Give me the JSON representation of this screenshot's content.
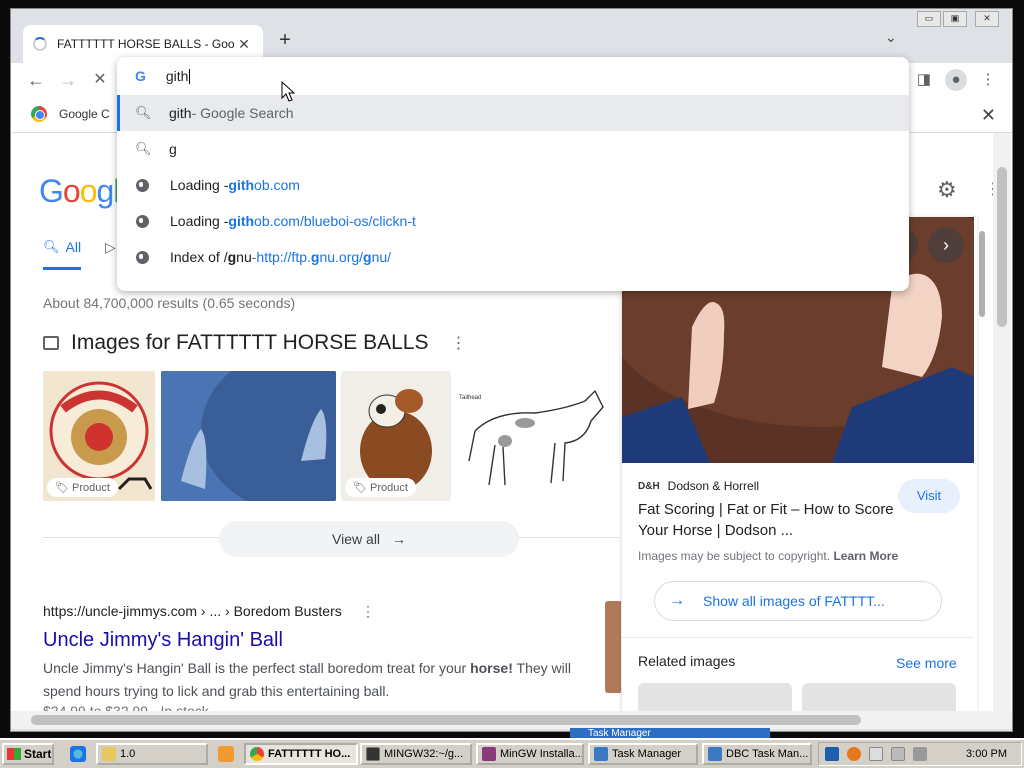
{
  "tab": {
    "title": "FATTTTTT HORSE BALLS - Google Search",
    "new_tab": "+",
    "close": "✕",
    "tab_search": "⌄"
  },
  "window_controls": [
    "▭",
    "▣",
    "✕"
  ],
  "omnibox": {
    "query": "gith",
    "suggestions": [
      {
        "main": "gith",
        "suffix": " - Google Search",
        "type": "search"
      },
      {
        "main": "g",
        "suffix": "",
        "type": "search"
      },
      {
        "main": "Loading - ",
        "bold": "gith",
        "rest": "ob.com",
        "type": "url"
      },
      {
        "main": "Loading - ",
        "bold": "gith",
        "rest": "ob.com/blueboi-os/clickn-t",
        "type": "url"
      },
      {
        "main": "Index of /",
        "g1": "g",
        "nu": "nu",
        "dash": " - ",
        "link_a": "http://ftp.",
        "g2": "g",
        "link_b": "nu.org/",
        "g3": "g",
        "link_c": "nu/",
        "type": "url"
      }
    ]
  },
  "bookmarks": {
    "first": "Google C"
  },
  "google": {
    "logo": "Googl",
    "tabs": {
      "all": "All"
    },
    "stats": "About 84,700,000 results (0.65 seconds)",
    "images_heading": "Images for FATTTTTT HORSE BALLS",
    "chip": "Product",
    "view_all": "View all",
    "result": {
      "url": "https://uncle-jimmys.com › ... › Boredom Busters",
      "title": "Uncle Jimmy's Hangin' Ball",
      "snippet_a": "Uncle Jimmy's Hangin' Ball is the perfect stall boredom treat for your ",
      "snippet_bold": "horse!",
      "snippet_b": " They will spend hours trying to lick and grab this entertaining ball.",
      "price": "$24.99 to $32.99 · In stock"
    },
    "panel": {
      "source_logo": "D&H",
      "source": "Dodson & Horrell",
      "visit": "Visit",
      "title": "Fat Scoring | Fat or Fit – How to Score Your Horse | Dodson ...",
      "copyright": "Images may be subject to copyright. ",
      "learn_more": "Learn More",
      "show_all": "Show all images of FATTTT...",
      "related": "Related images",
      "see_more": "See more"
    }
  },
  "taskbar": {
    "start": "Start",
    "items": [
      "1.0",
      "FATTTTTT HO...",
      "MINGW32:~/g...",
      "MinGW Installa...",
      "Task Manager",
      "DBC Task Man..."
    ],
    "clock": "3:00 PM",
    "task_manager_hint": "Task Manager"
  }
}
